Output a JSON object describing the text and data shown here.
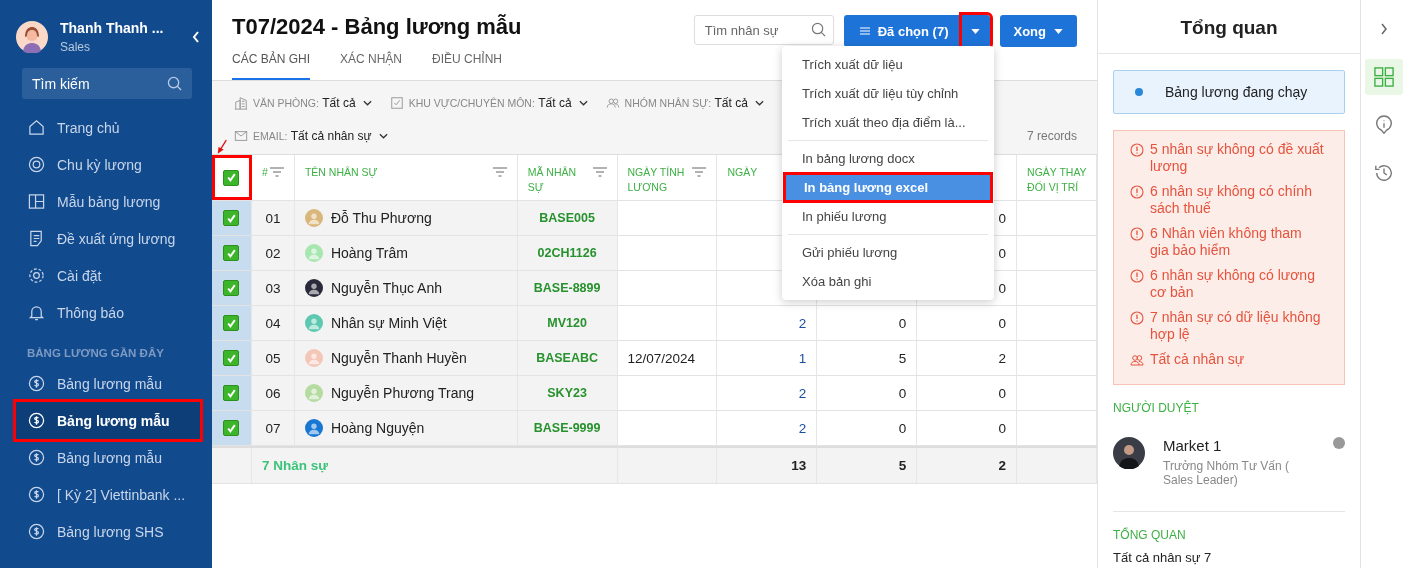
{
  "sidebar": {
    "user": {
      "name": "Thanh Thanh ...",
      "role": "Sales"
    },
    "search": {
      "placeholder": "Tìm kiếm"
    },
    "items": [
      {
        "label": "Trang chủ",
        "kind": "home"
      },
      {
        "label": "Chu kỳ lương",
        "kind": "cycle"
      },
      {
        "label": "Mẫu bảng lương",
        "kind": "layout"
      },
      {
        "label": "Đề xuất ứng lương",
        "kind": "doc"
      },
      {
        "label": "Cài đặt",
        "kind": "gear"
      },
      {
        "label": "Thông báo",
        "kind": "bell"
      }
    ],
    "recent_title": "BẢNG LƯƠNG GẦN ĐÂY",
    "recent": [
      {
        "label": "Bảng lương mẫu",
        "selected": false,
        "annotated": false
      },
      {
        "label": "Bảng lương mẫu",
        "selected": true,
        "annotated": true
      },
      {
        "label": "Bảng lương mẫu",
        "selected": false,
        "annotated": false
      },
      {
        "label": "[ Kỳ 2] Viettinbank ...",
        "selected": false,
        "annotated": false
      },
      {
        "label": "Bảng lương SHS",
        "selected": false,
        "annotated": false
      }
    ]
  },
  "header": {
    "title": "T07/2024 - Bảng lương mẫu",
    "search": {
      "placeholder": "Tìm nhân sự"
    },
    "selected_button": "Đã chọn (7)",
    "dropdown_annotated": true,
    "done_button": "Xong",
    "tabs": [
      {
        "label": "CÁC BẢN GHI",
        "selected": true
      },
      {
        "label": "XÁC NHẬN",
        "selected": false
      },
      {
        "label": "ĐIỀU CHỈNH",
        "selected": false
      }
    ]
  },
  "filters": [
    {
      "kind": "office",
      "label": "VĂN PHÒNG:",
      "value": "Tất cả"
    },
    {
      "kind": "area",
      "label": "KHU VỰC/CHUYÊN MÔN:",
      "value": "Tất cả"
    },
    {
      "kind": "group",
      "label": "NHÓM NHÂN SỰ:",
      "value": "Tất cả"
    },
    {
      "kind": "email",
      "label": "EMAIL:",
      "value": "Tất cả nhân sự"
    }
  ],
  "records": "7 records",
  "table": {
    "select_all": {
      "checked": true,
      "annotated": true
    },
    "columns": [
      "#",
      "TÊN NHÂN SỰ",
      "MÃ NHÂN SỰ",
      "NGÀY TÍNH LƯƠNG",
      "NGÀY",
      "",
      "",
      "NGÀY THAY ĐỔI VỊ TRÍ"
    ],
    "rows": [
      {
        "checked": true,
        "no": "01",
        "name": "Đỗ Thu Phương",
        "color": "#d9b77a",
        "code": "BASE005",
        "date": "",
        "c6": "",
        "c7": "",
        "c8": "0"
      },
      {
        "checked": true,
        "no": "02",
        "name": "Hoàng Trâm",
        "color": "#a8e6b0",
        "code": "02CH1126",
        "date": "",
        "c6": "",
        "c7": "",
        "c8": "0"
      },
      {
        "checked": true,
        "no": "03",
        "name": "Nguyễn Thục Anh",
        "color": "#2a2a3a",
        "code": "BASE-8899",
        "date": "",
        "c6": "",
        "c7": "",
        "c8": "0"
      },
      {
        "checked": true,
        "no": "04",
        "name": "Nhân sự Minh Việt",
        "color": "#5cc8b0",
        "code": "MV120",
        "date": "",
        "c6": "2",
        "c7": "0",
        "c8": "0"
      },
      {
        "checked": true,
        "no": "05",
        "name": "Nguyễn Thanh Huyền",
        "color": "#f4c6b8",
        "code": "BASEABC",
        "date": "12/07/2024",
        "c6": "1",
        "c7": "5",
        "c8": "2"
      },
      {
        "checked": true,
        "no": "06",
        "name": "Nguyễn Phương Trang",
        "color": "#b5dba0",
        "code": "SKY23",
        "date": "",
        "c6": "2",
        "c7": "0",
        "c8": "0"
      },
      {
        "checked": true,
        "no": "07",
        "name": "Hoàng Nguyện",
        "color": "#1877d2",
        "code": "BASE-9999",
        "date": "",
        "c6": "2",
        "c7": "0",
        "c8": "0"
      }
    ],
    "footer": {
      "count": "7 Nhân sự",
      "c6": "13",
      "c7": "5",
      "c8": "2"
    }
  },
  "menu": {
    "groups": [
      [
        {
          "label": "Trích xuất dữ liệu",
          "selected": false
        },
        {
          "label": "Trích xuất dữ liệu tùy chỉnh",
          "selected": false
        },
        {
          "label": "Trích xuất theo địa điểm là...",
          "selected": false
        }
      ],
      [
        {
          "label": "In bảng lương docx",
          "selected": false
        },
        {
          "label": "In bảng lương excel",
          "selected": true
        },
        {
          "label": "In phiếu lương",
          "selected": false
        }
      ],
      [
        {
          "label": "Gửi phiếu lương",
          "selected": false
        },
        {
          "label": "Xóa bản ghi",
          "selected": false
        }
      ]
    ]
  },
  "panel": {
    "title": "Tổng quan",
    "status": "Bảng lương đang chạy",
    "warnings": [
      {
        "kind": "warning",
        "text": "5 nhân sự không có đề xuất lương"
      },
      {
        "kind": "warning",
        "text": "6 nhân sự không có chính sách thuế"
      },
      {
        "kind": "warning",
        "text": "6 Nhân viên không tham gia bảo hiểm"
      },
      {
        "kind": "warning",
        "text": "6 nhân sự không có lương cơ bản"
      },
      {
        "kind": "warning",
        "text": "7 nhân sự có dữ liệu không hợp lệ"
      },
      {
        "kind": "people",
        "text": "Tất cả nhân sự"
      }
    ],
    "reviewers_title": "NGƯỜI DUYỆT",
    "reviewer": {
      "name": "Market 1",
      "role": "Trưởng Nhóm Tư Vấn ( Sales Leader)",
      "online": false
    },
    "overview_title": "TỔNG QUAN",
    "overview_line": "Tất cả nhân sự 7"
  },
  "rail": [
    {
      "kind": "grid",
      "selected": true
    },
    {
      "kind": "info",
      "selected": false
    },
    {
      "kind": "history",
      "selected": false
    }
  ]
}
